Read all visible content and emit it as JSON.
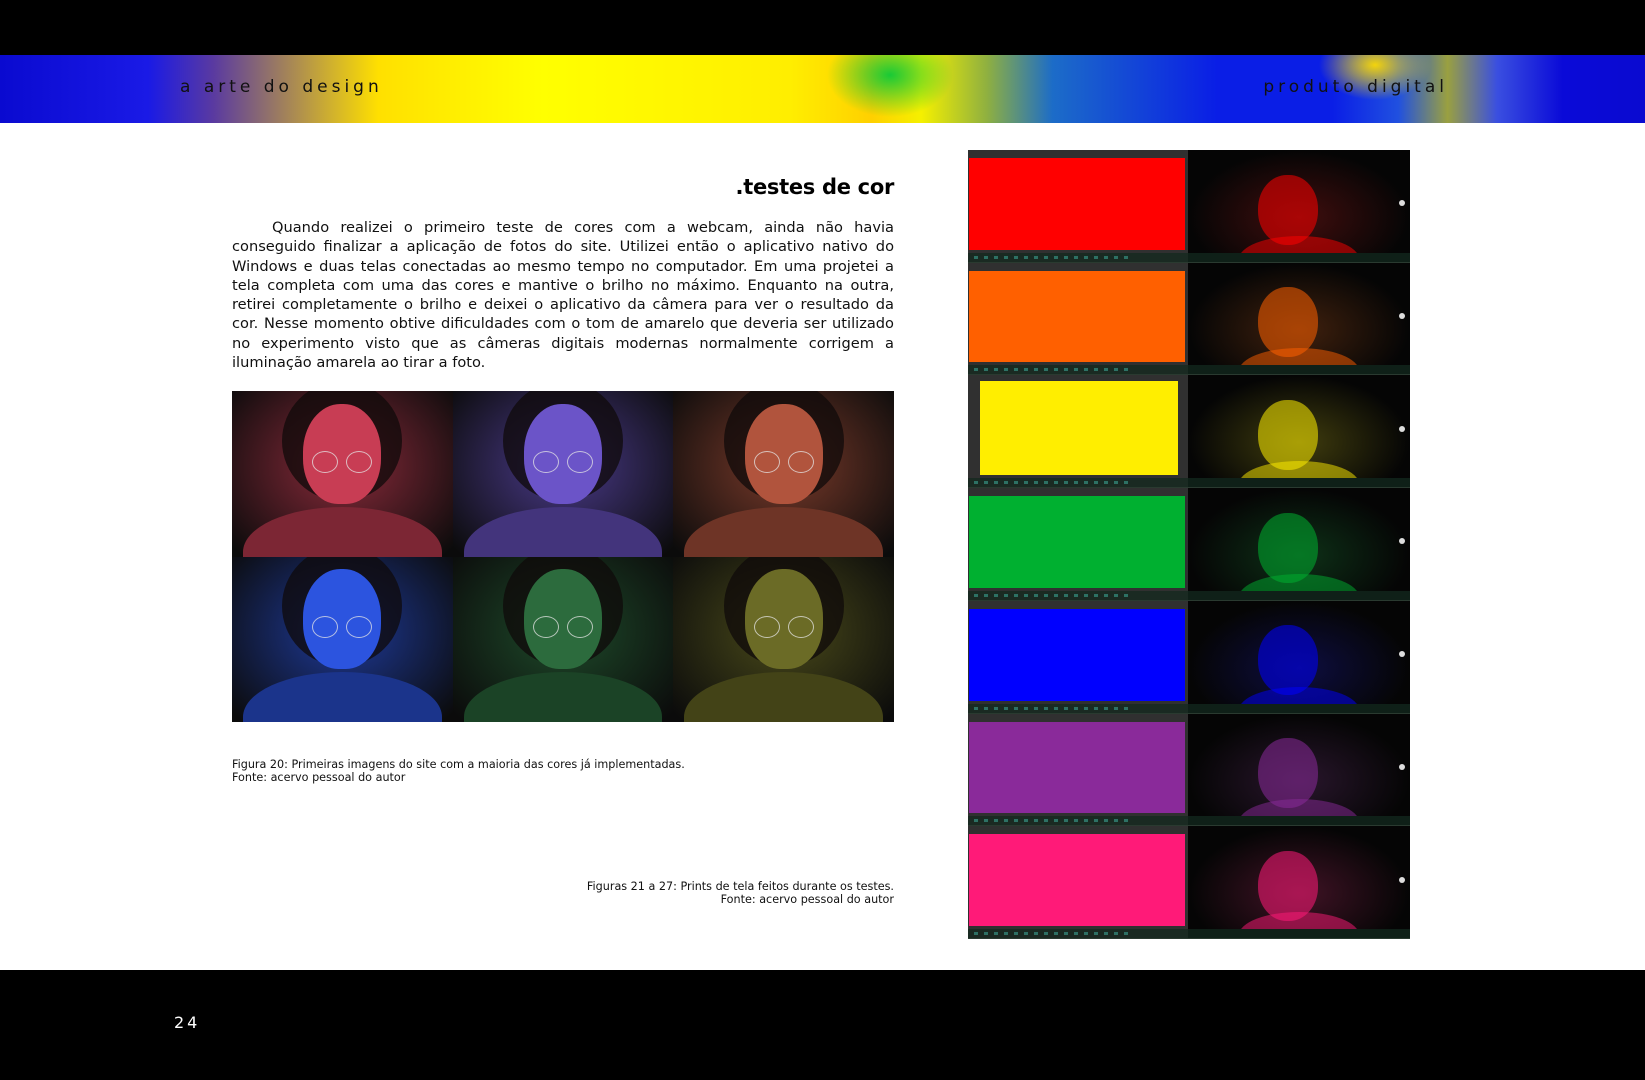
{
  "header": {
    "left_text": "a arte do design",
    "right_text": "produto digital"
  },
  "section": {
    "title": ".testes de cor",
    "paragraph": "Quando realizei o primeiro teste de cores com a webcam, ainda não havia conseguido finalizar a aplicação de fotos do site. Utilizei então o aplicativo nativo do Windows e duas telas conectadas ao mesmo tempo no computador. Em uma projetei a tela completa com uma das cores e mantive o brilho no máximo. Enquanto na outra, retirei completamente o brilho e deixei o aplicativo da câmera para ver o resultado da cor. Nesse momento obtive dificuldades com o tom de amarelo que deveria ser utilizado no experimento visto que as câmeras digitais modernas normalmente corrigem a iluminação amarela ao tirar a foto."
  },
  "figure20": {
    "caption_line1": "Figura 20: Primeiras imagens do site com a maioria das cores já implementadas.",
    "caption_line2": "Fonte: acervo pessoal do autor",
    "photos": [
      {
        "tint": "#8a2a3a"
      },
      {
        "tint": "#4a3a8a"
      },
      {
        "tint": "#7a3a2a"
      },
      {
        "tint": "#1e3a9a"
      },
      {
        "tint": "#1e4a2a"
      },
      {
        "tint": "#4a4a1a"
      }
    ]
  },
  "figure21_27": {
    "caption_line1": "Figuras 21 a 27: Prints de tela feitos durante os testes.",
    "caption_line2": "Fonte: acervo pessoal do autor",
    "swatches": [
      "#ff0000",
      "#ff6000",
      "#ffee00",
      "#00b030",
      "#0000ff",
      "#8a2a9a",
      "#ff1a78"
    ]
  },
  "footer": {
    "page_number": "24"
  }
}
